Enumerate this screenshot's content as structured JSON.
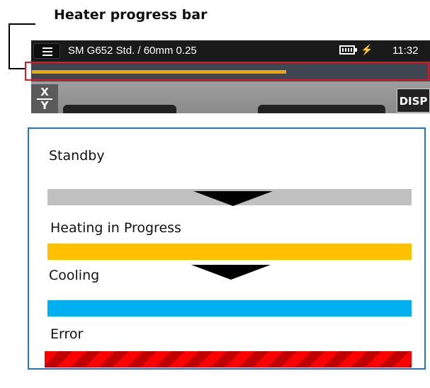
{
  "caption": "Heater progress bar",
  "topbar": {
    "fiber_info": "SM G652 Std. / 60mm 0.25",
    "clock": "11:32",
    "charging_symbol": "⚡"
  },
  "progress": {
    "fill_fraction": 0.64,
    "color": "#f0a800"
  },
  "buttons": {
    "xy_top": "X",
    "xy_bottom": "Y",
    "disp": "DISP"
  },
  "legend": {
    "standby": {
      "label": "Standby",
      "color": "#c0c0c0"
    },
    "heating": {
      "label": "Heating in Progress",
      "color": "#ffc000"
    },
    "cooling": {
      "label": "Cooling",
      "color": "#00b0f0"
    },
    "error": {
      "label": "Error",
      "colors": [
        "#ff0000",
        "#c00000"
      ]
    }
  },
  "colors": {
    "highlight": "#e8141c",
    "legend_border": "#1f77c2"
  }
}
